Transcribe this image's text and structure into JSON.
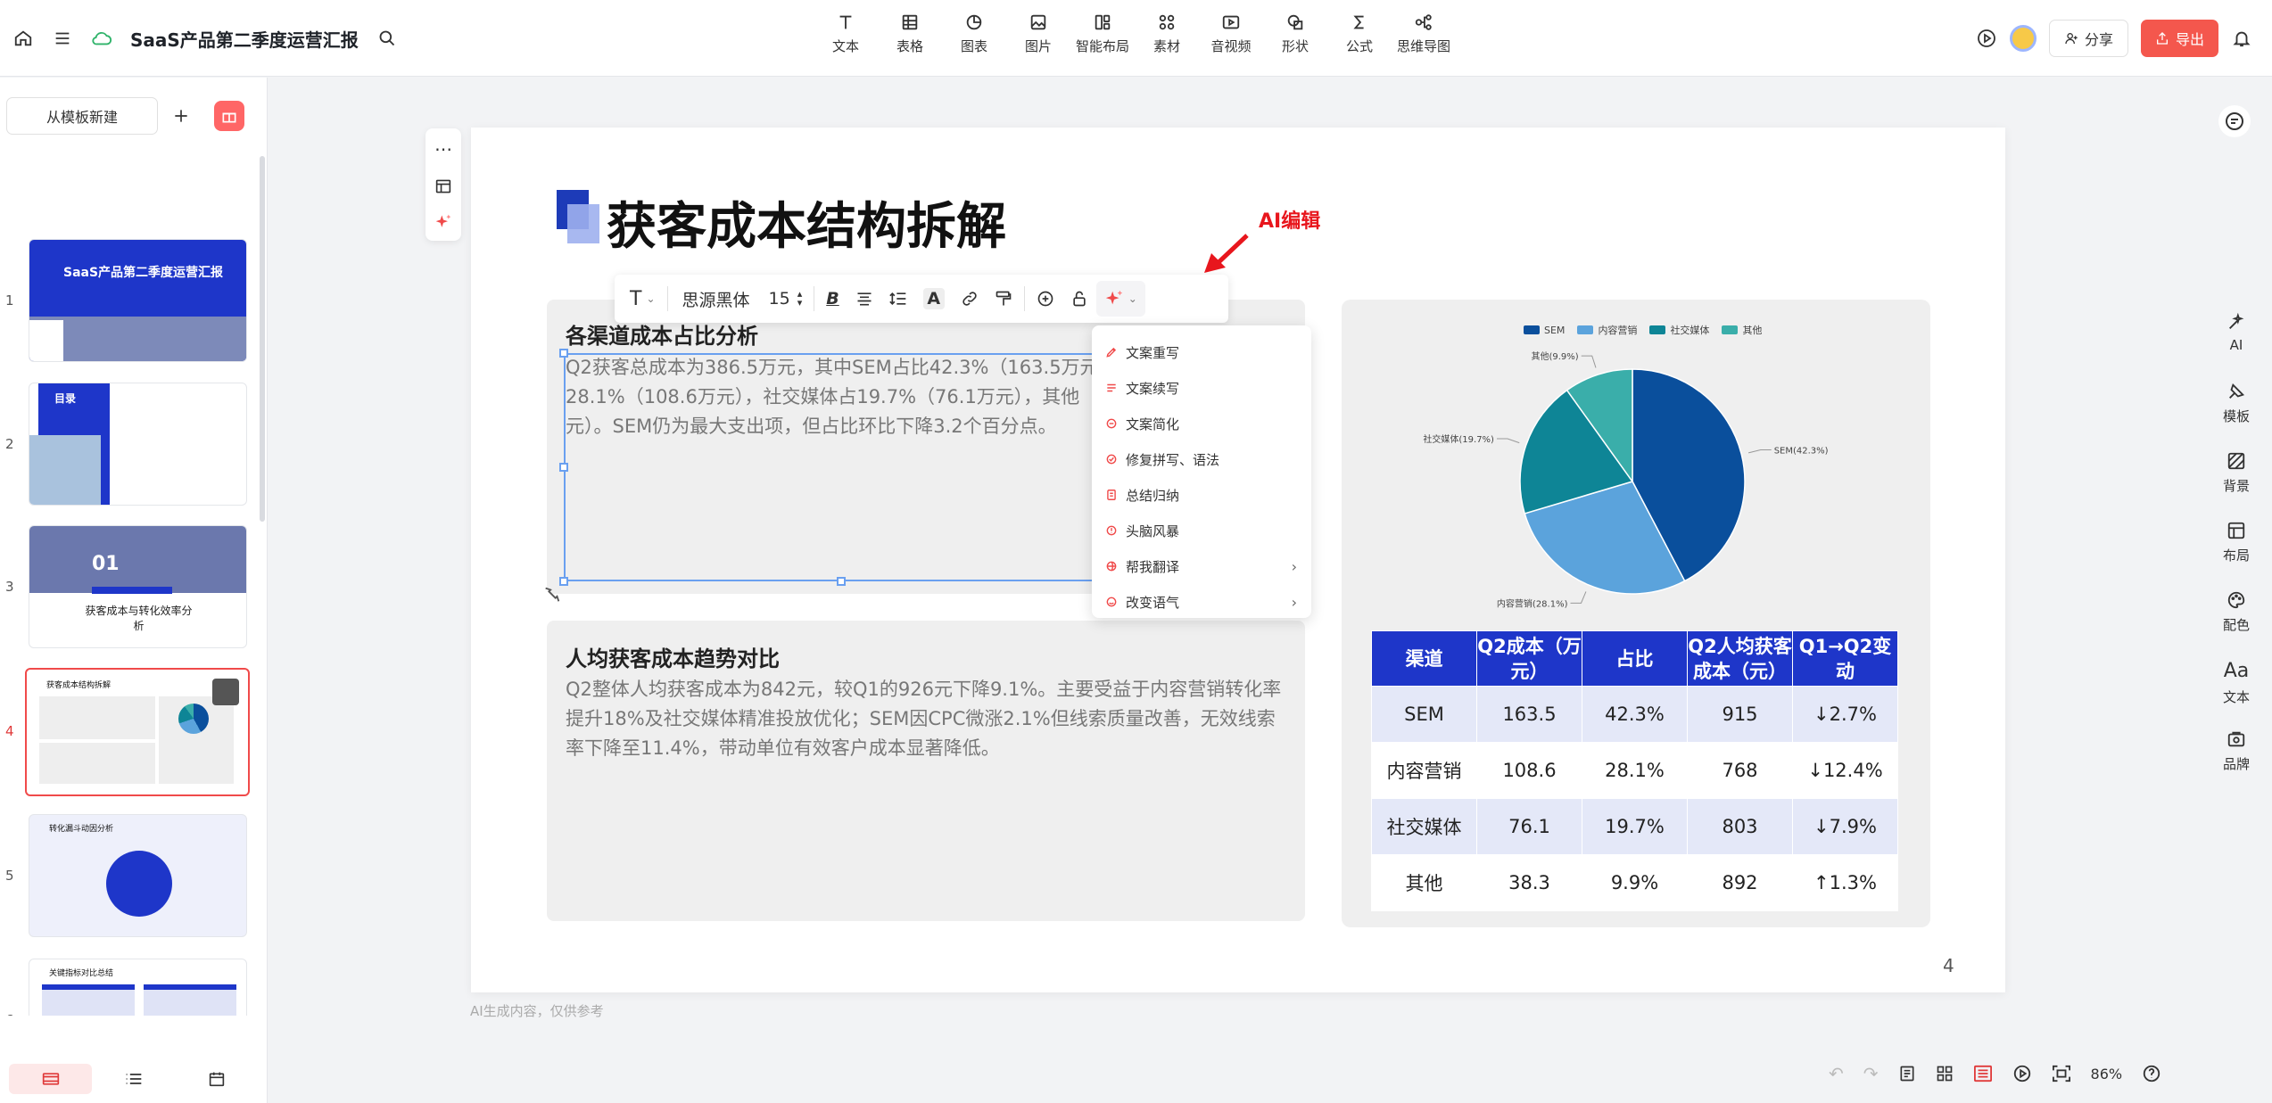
{
  "topbar": {
    "doc_title": "SaaS产品第二季度运营汇报",
    "tools": [
      {
        "label": "文本",
        "icon": "text-icon"
      },
      {
        "label": "表格",
        "icon": "table-icon"
      },
      {
        "label": "图表",
        "icon": "chart-icon"
      },
      {
        "label": "图片",
        "icon": "image-icon"
      },
      {
        "label": "智能布局",
        "icon": "smart-layout-icon"
      },
      {
        "label": "素材",
        "icon": "material-icon"
      },
      {
        "label": "音视频",
        "icon": "video-icon"
      },
      {
        "label": "形状",
        "icon": "shape-icon"
      },
      {
        "label": "公式",
        "icon": "formula-icon"
      },
      {
        "label": "思维导图",
        "icon": "mindmap-icon"
      }
    ],
    "share_label": "分享",
    "export_label": "导出"
  },
  "sidebar": {
    "new_template_label": "从模板新建",
    "slides": [
      {
        "num": "1",
        "title": "SaaS产品第二季度运营汇报"
      },
      {
        "num": "2",
        "title": "目录"
      },
      {
        "num": "3",
        "title": "获客成本与转化效率分析",
        "section": "01"
      },
      {
        "num": "4",
        "title": "获客成本结构拆解",
        "active": true
      },
      {
        "num": "5",
        "title": "转化漏斗动因分析"
      },
      {
        "num": "6",
        "title": "关键指标对比总结"
      }
    ]
  },
  "slide": {
    "title": "获客成本结构拆解",
    "card1": {
      "heading": "各渠道成本占比分析",
      "lines": [
        "Q2获客总成本为386.5万元，其中SEM占比42.3%（163.5万元），",
        "28.1%（108.6万元），社交媒体占19.7%（76.1万元），其他",
        "元）。SEM仍为最大支出项，但占比环比下降3.2个百分点。"
      ]
    },
    "card2": {
      "heading": "人均获客成本趋势对比",
      "lines": [
        "Q2整体人均获客成本为842元，较Q1的926元下降9.1%。主要受益于内容营销转化率",
        "提升18%及社交媒体精准投放优化；SEM因CPC微涨2.1%但线索质量改善，无效线索",
        "率下降至11.4%，带动单位有效客户成本显著降低。"
      ]
    },
    "table": {
      "headers": [
        "渠道",
        "Q2成本（万元）",
        "占比",
        "Q2人均获客成本（元）",
        "Q1→Q2变动"
      ],
      "rows": [
        [
          "SEM",
          "163.5",
          "42.3%",
          "915",
          "↓2.7%"
        ],
        [
          "内容营销",
          "108.6",
          "28.1%",
          "768",
          "↓12.4%"
        ],
        [
          "社交媒体",
          "76.1",
          "19.7%",
          "803",
          "↓7.9%"
        ],
        [
          "其他",
          "38.3",
          "9.9%",
          "892",
          "↑1.3%"
        ]
      ]
    },
    "page_number": "4"
  },
  "chart_data": {
    "type": "pie",
    "categories": [
      "SEM",
      "内容营销",
      "社交媒体",
      "其他"
    ],
    "values": [
      42.3,
      28.1,
      19.7,
      9.9
    ],
    "slice_labels": [
      "SEM(42.3%)",
      "内容营销(28.1%)",
      "社交媒体(19.7%)",
      "其他(9.9%)"
    ],
    "colors": [
      "#0a4f9c",
      "#5ba3dc",
      "#0e8596",
      "#3aaeaa"
    ],
    "legend_position": "top"
  },
  "text_toolbar": {
    "font_name": "思源黑体",
    "font_size": "15"
  },
  "ai_menu": {
    "items": [
      {
        "label": "文案重写",
        "icon": "pen-icon"
      },
      {
        "label": "文案续写",
        "icon": "list-icon"
      },
      {
        "label": "文案简化",
        "icon": "simplify-icon"
      },
      {
        "label": "修复拼写、语法",
        "icon": "fix-icon"
      },
      {
        "label": "总结归纳",
        "icon": "summary-icon"
      },
      {
        "label": "头脑风暴",
        "icon": "brainstorm-icon"
      },
      {
        "label": "帮我翻译",
        "icon": "translate-icon",
        "submenu": true
      },
      {
        "label": "改变语气",
        "icon": "tone-icon",
        "submenu": true
      }
    ]
  },
  "annotation": {
    "label": "AI编辑",
    "color": "#e8161d"
  },
  "ai_note": "AI生成内容，仅供参考",
  "right_rail": [
    {
      "label": "AI",
      "icon": "ai-icon"
    },
    {
      "label": "模板",
      "icon": "template-icon"
    },
    {
      "label": "背景",
      "icon": "background-icon"
    },
    {
      "label": "布局",
      "icon": "layout-icon"
    },
    {
      "label": "配色",
      "icon": "palette-icon"
    },
    {
      "label": "文本",
      "icon": "text-style-icon",
      "glyph": "Aa"
    },
    {
      "label": "品牌",
      "icon": "brand-icon"
    }
  ],
  "status": {
    "zoom": "86%"
  }
}
